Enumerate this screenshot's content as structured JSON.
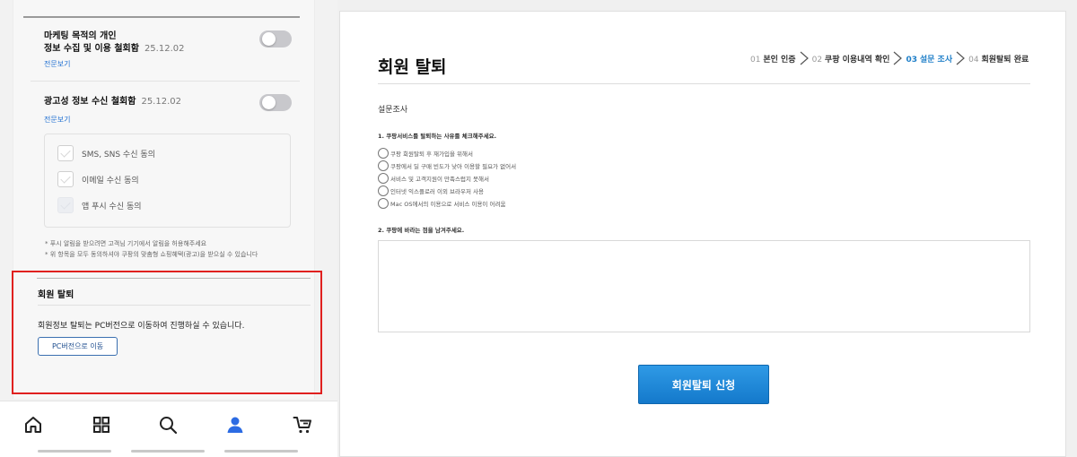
{
  "mobile": {
    "marketing": {
      "title_line1": "마케팅 목적의 개인",
      "title_line2": "정보 수집 및 이용 철회함",
      "date": "25.12.02",
      "link": "전문보기"
    },
    "ads": {
      "title": "광고성 정보 수신 철회함",
      "date": "25.12.02",
      "link": "전문보기"
    },
    "sub_options": [
      {
        "label": "SMS, SNS 수신 동의"
      },
      {
        "label": "이메일 수신 동의"
      },
      {
        "label": "앱 푸시 수신 동의"
      }
    ],
    "notes": [
      "* 푸시 알림을 받으려면 고객님 기기에서 알림을 허용해주세요",
      "* 위 항목을 모두 동의하셔야 쿠팡의 맞춤형 쇼핑혜택(광고)을 받으실 수 있습니다"
    ],
    "withdraw": {
      "title": "회원 탈퇴",
      "desc": "회원정보 탈퇴는 PC버전으로 이동하여 진행하실 수 있습니다.",
      "button": "PC버전으로 이동"
    },
    "nav": [
      "home-icon",
      "grid-icon",
      "search-icon",
      "user-icon",
      "cart-icon"
    ],
    "colors": {
      "accent": "#1f6fd1",
      "highlight_border": "#e0201f",
      "active_user": "#2b6be3"
    }
  },
  "pc": {
    "title": "회원 탈퇴",
    "steps": [
      {
        "num": "01",
        "label": "본인 인증"
      },
      {
        "num": "02",
        "label": "쿠팡 이용내역 확인"
      },
      {
        "num": "03",
        "label": "설문 조사"
      },
      {
        "num": "04",
        "label": "회원탈퇴 완료"
      }
    ],
    "active_step": 3,
    "survey_title": "설문조사",
    "q1": "1. 쿠팡서비스를 탈퇴하는 사유를 체크해주세요.",
    "options": [
      "쿠팡 회원탈퇴 후 재가입을 위해서",
      "쿠팡에서 딜 구매 빈도가 낮아 이용할 필요가 없어서",
      "서비스 및 고객지원이 만족스럽지 못해서",
      "인터넷 익스플로러 이외 브라우저 사용",
      "Mac OS에서의 이용으로 서비스 이용이 어려움"
    ],
    "q2": "2. 쿠팡에 바라는 점을 남겨주세요.",
    "submit": "회원탈퇴 신청",
    "colors": {
      "step_active": "#1f7fc8",
      "button": "#1a85d6"
    }
  }
}
